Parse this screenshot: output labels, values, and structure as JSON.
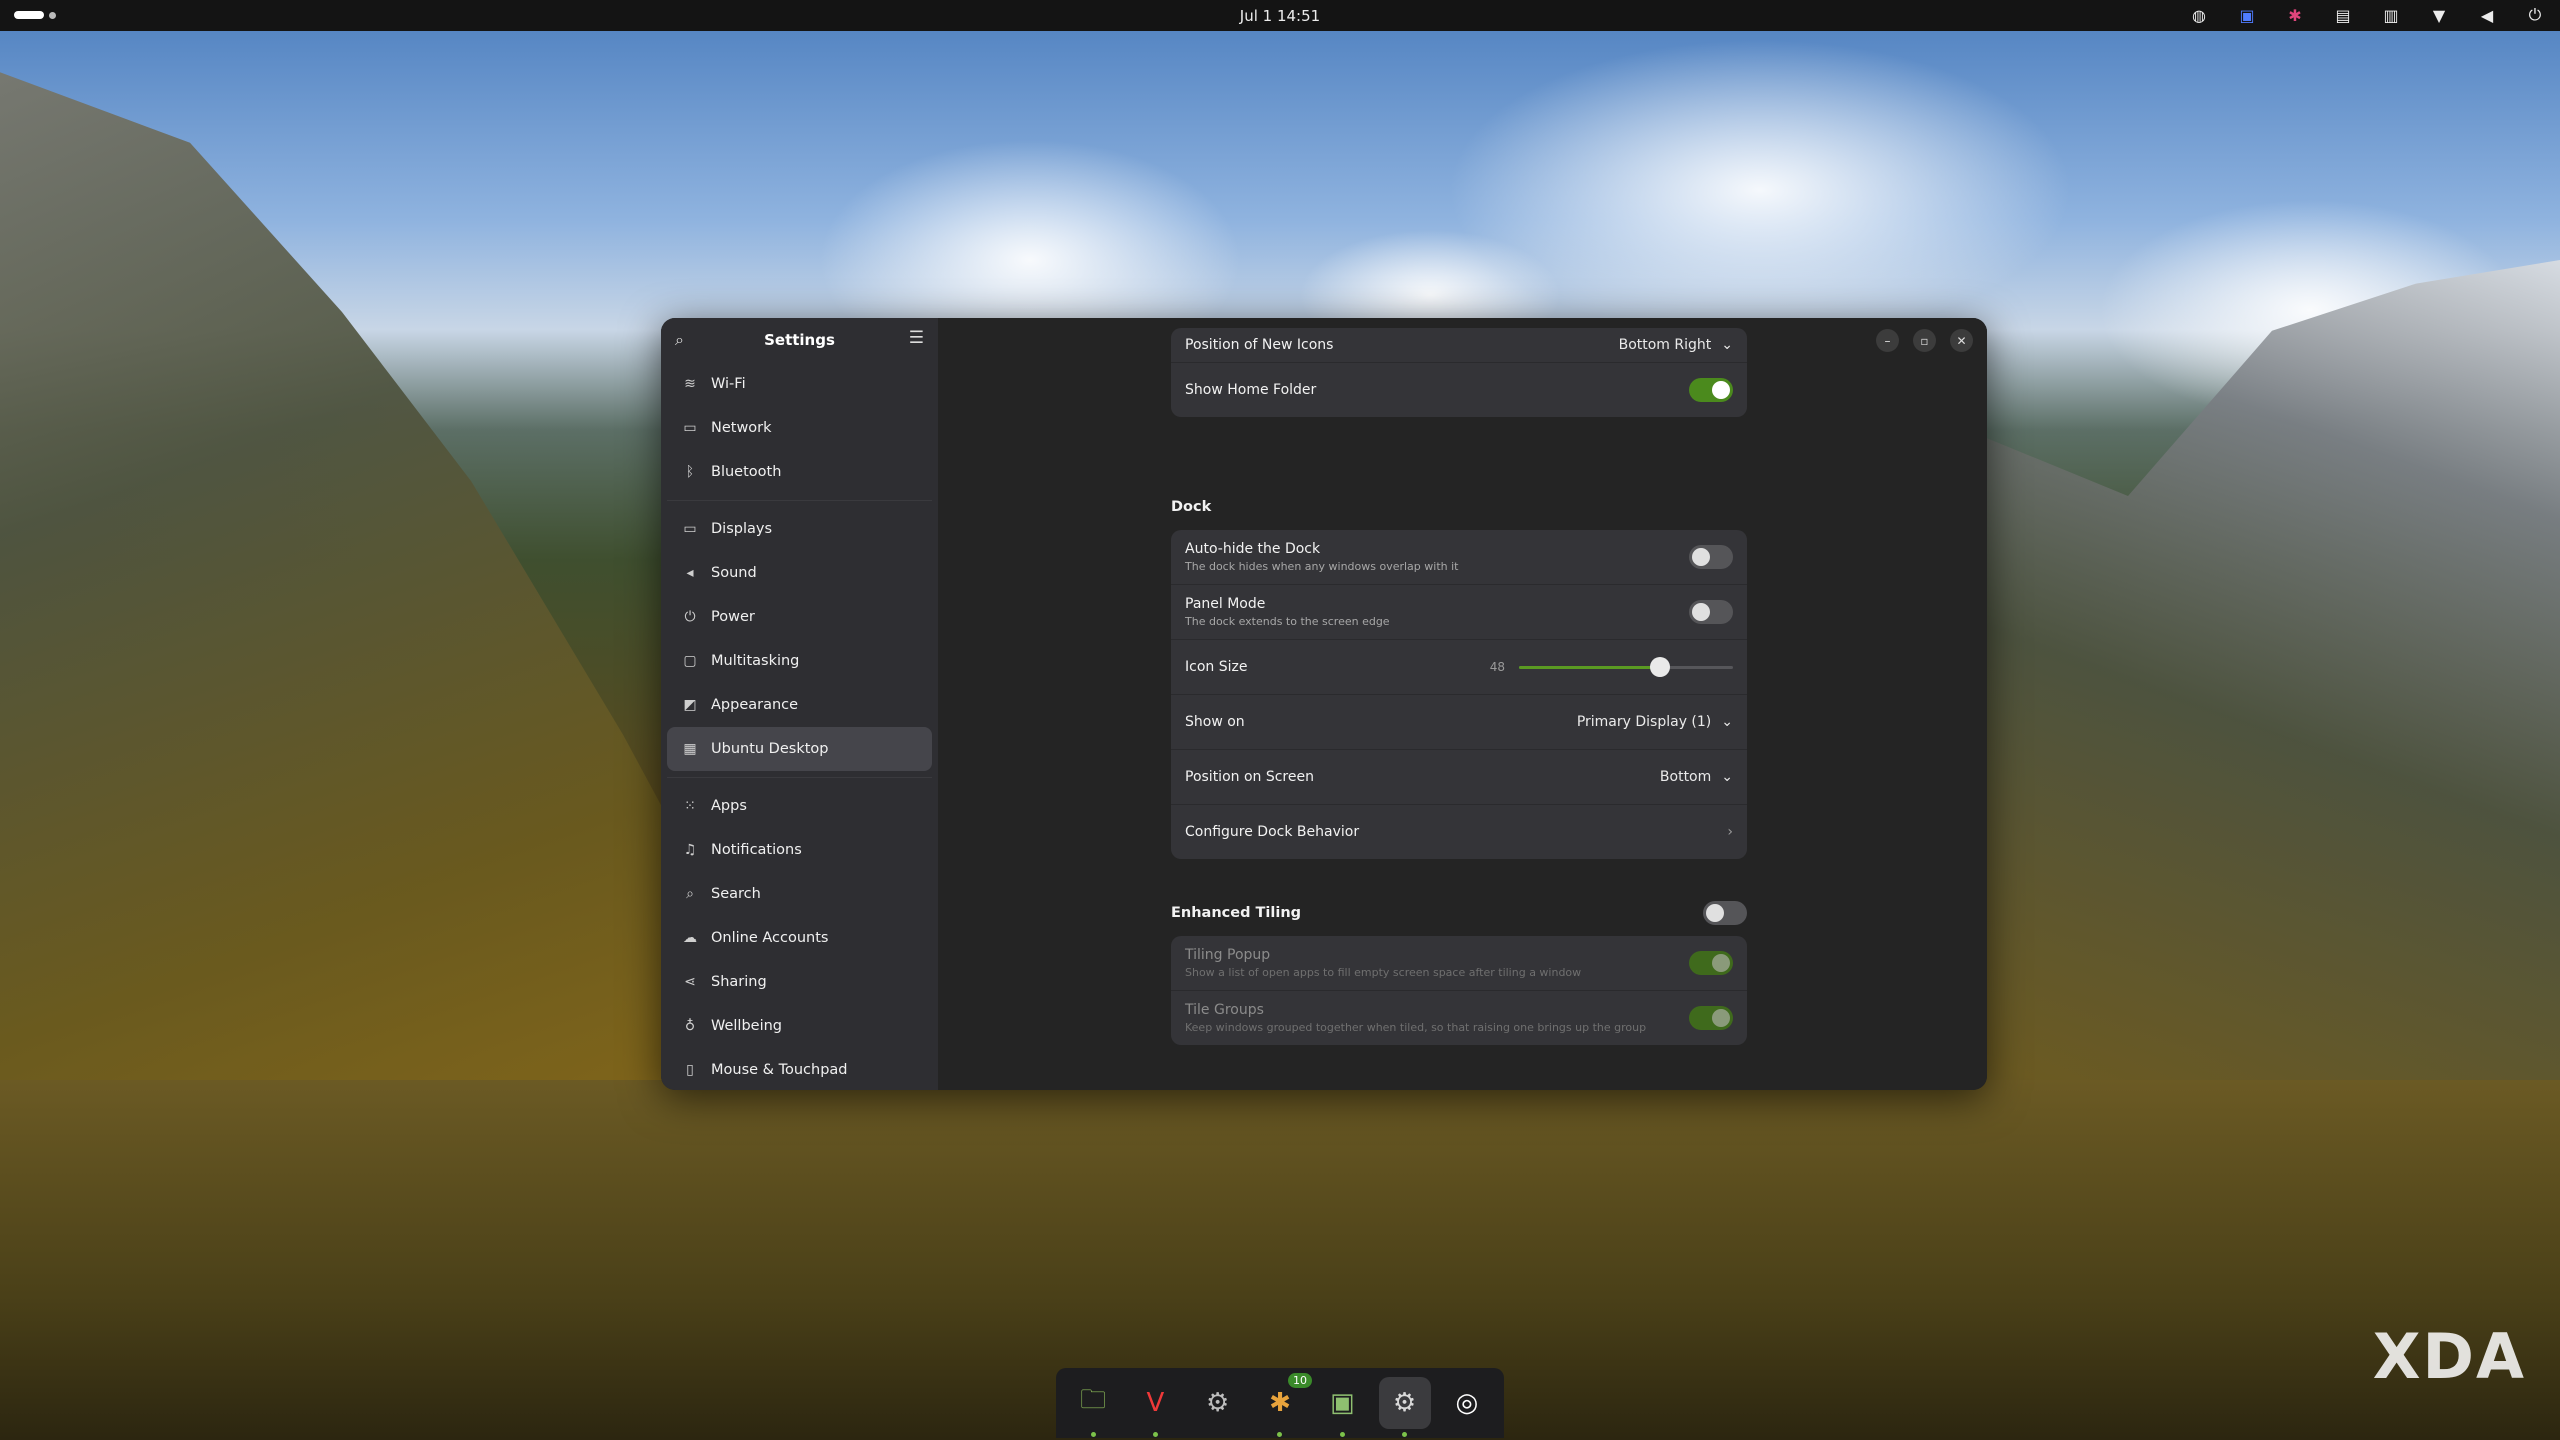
{
  "topbar": {
    "clock": "Jul 1  14:51",
    "tray_icons": [
      "screenshot-icon",
      "app-indicator-icon",
      "slack-tray-icon",
      "clipboard-icon",
      "layout-icon",
      "wifi-icon",
      "volume-icon",
      "power-icon"
    ]
  },
  "window": {
    "sidebar_title": "Settings",
    "content_title": "Ubuntu Desktop",
    "sidebar": {
      "groups": [
        [
          {
            "label": "Wi-Fi",
            "icon": "wifi-icon"
          },
          {
            "label": "Network",
            "icon": "network-icon"
          },
          {
            "label": "Bluetooth",
            "icon": "bluetooth-icon"
          }
        ],
        [
          {
            "label": "Displays",
            "icon": "display-icon"
          },
          {
            "label": "Sound",
            "icon": "sound-icon"
          },
          {
            "label": "Power",
            "icon": "power-icon"
          },
          {
            "label": "Multitasking",
            "icon": "multitasking-icon"
          },
          {
            "label": "Appearance",
            "icon": "appearance-icon"
          },
          {
            "label": "Ubuntu Desktop",
            "icon": "ubuntu-desktop-icon",
            "active": true
          }
        ],
        [
          {
            "label": "Apps",
            "icon": "apps-icon"
          },
          {
            "label": "Notifications",
            "icon": "bell-icon"
          },
          {
            "label": "Search",
            "icon": "search-icon"
          },
          {
            "label": "Online Accounts",
            "icon": "cloud-icon"
          },
          {
            "label": "Sharing",
            "icon": "share-icon"
          },
          {
            "label": "Wellbeing",
            "icon": "wellbeing-icon"
          },
          {
            "label": "Mouse & Touchpad",
            "icon": "mouse-icon"
          }
        ]
      ]
    },
    "desktop_icons": {
      "position_label": "Position of New Icons",
      "position_value": "Bottom Right",
      "home_folder_label": "Show Home Folder",
      "home_folder_on": true
    },
    "dock": {
      "title": "Dock",
      "autohide_label": "Auto-hide the Dock",
      "autohide_sub": "The dock hides when any windows overlap with it",
      "autohide_on": false,
      "panel_label": "Panel Mode",
      "panel_sub": "The dock extends to the screen edge",
      "panel_on": false,
      "icon_size_label": "Icon Size",
      "icon_size_value": "48",
      "icon_size_fraction": 0.66,
      "show_on_label": "Show on",
      "show_on_value": "Primary Display (1)",
      "position_label": "Position on Screen",
      "position_value": "Bottom",
      "configure_label": "Configure Dock Behavior"
    },
    "tiling": {
      "title": "Enhanced Tiling",
      "enabled": false,
      "popup_label": "Tiling Popup",
      "popup_sub": "Show a list of open apps to fill empty screen space after tiling a window",
      "popup_on": true,
      "groups_label": "Tile Groups",
      "groups_sub": "Keep windows grouped together when tiled, so that raising one brings up the group",
      "groups_on": true
    }
  },
  "dock_apps": [
    {
      "name": "files-icon",
      "glyph": "🗀",
      "color": "#8fbf5a",
      "running": true
    },
    {
      "name": "vivaldi-icon",
      "glyph": "V",
      "color": "#ef3939",
      "running": true
    },
    {
      "name": "settings-app-icon",
      "glyph": "⚙",
      "color": "#bdbdbd",
      "running": false
    },
    {
      "name": "slack-icon",
      "glyph": "✱",
      "color": "#e8a33c",
      "running": true,
      "badge": "10"
    },
    {
      "name": "switch-icon",
      "glyph": "▣",
      "color": "#8fc070",
      "running": true
    },
    {
      "name": "gnome-settings-icon",
      "glyph": "⚙",
      "color": "#d9d9d9",
      "running": true,
      "active": true
    },
    {
      "name": "ubuntu-icon",
      "glyph": "◎",
      "color": "#ffffff",
      "running": false
    }
  ],
  "watermark": "XDA",
  "colors": {
    "accent": "#4b8a1d",
    "window_bg": "#242424",
    "sidebar_bg": "#2e2e32"
  }
}
